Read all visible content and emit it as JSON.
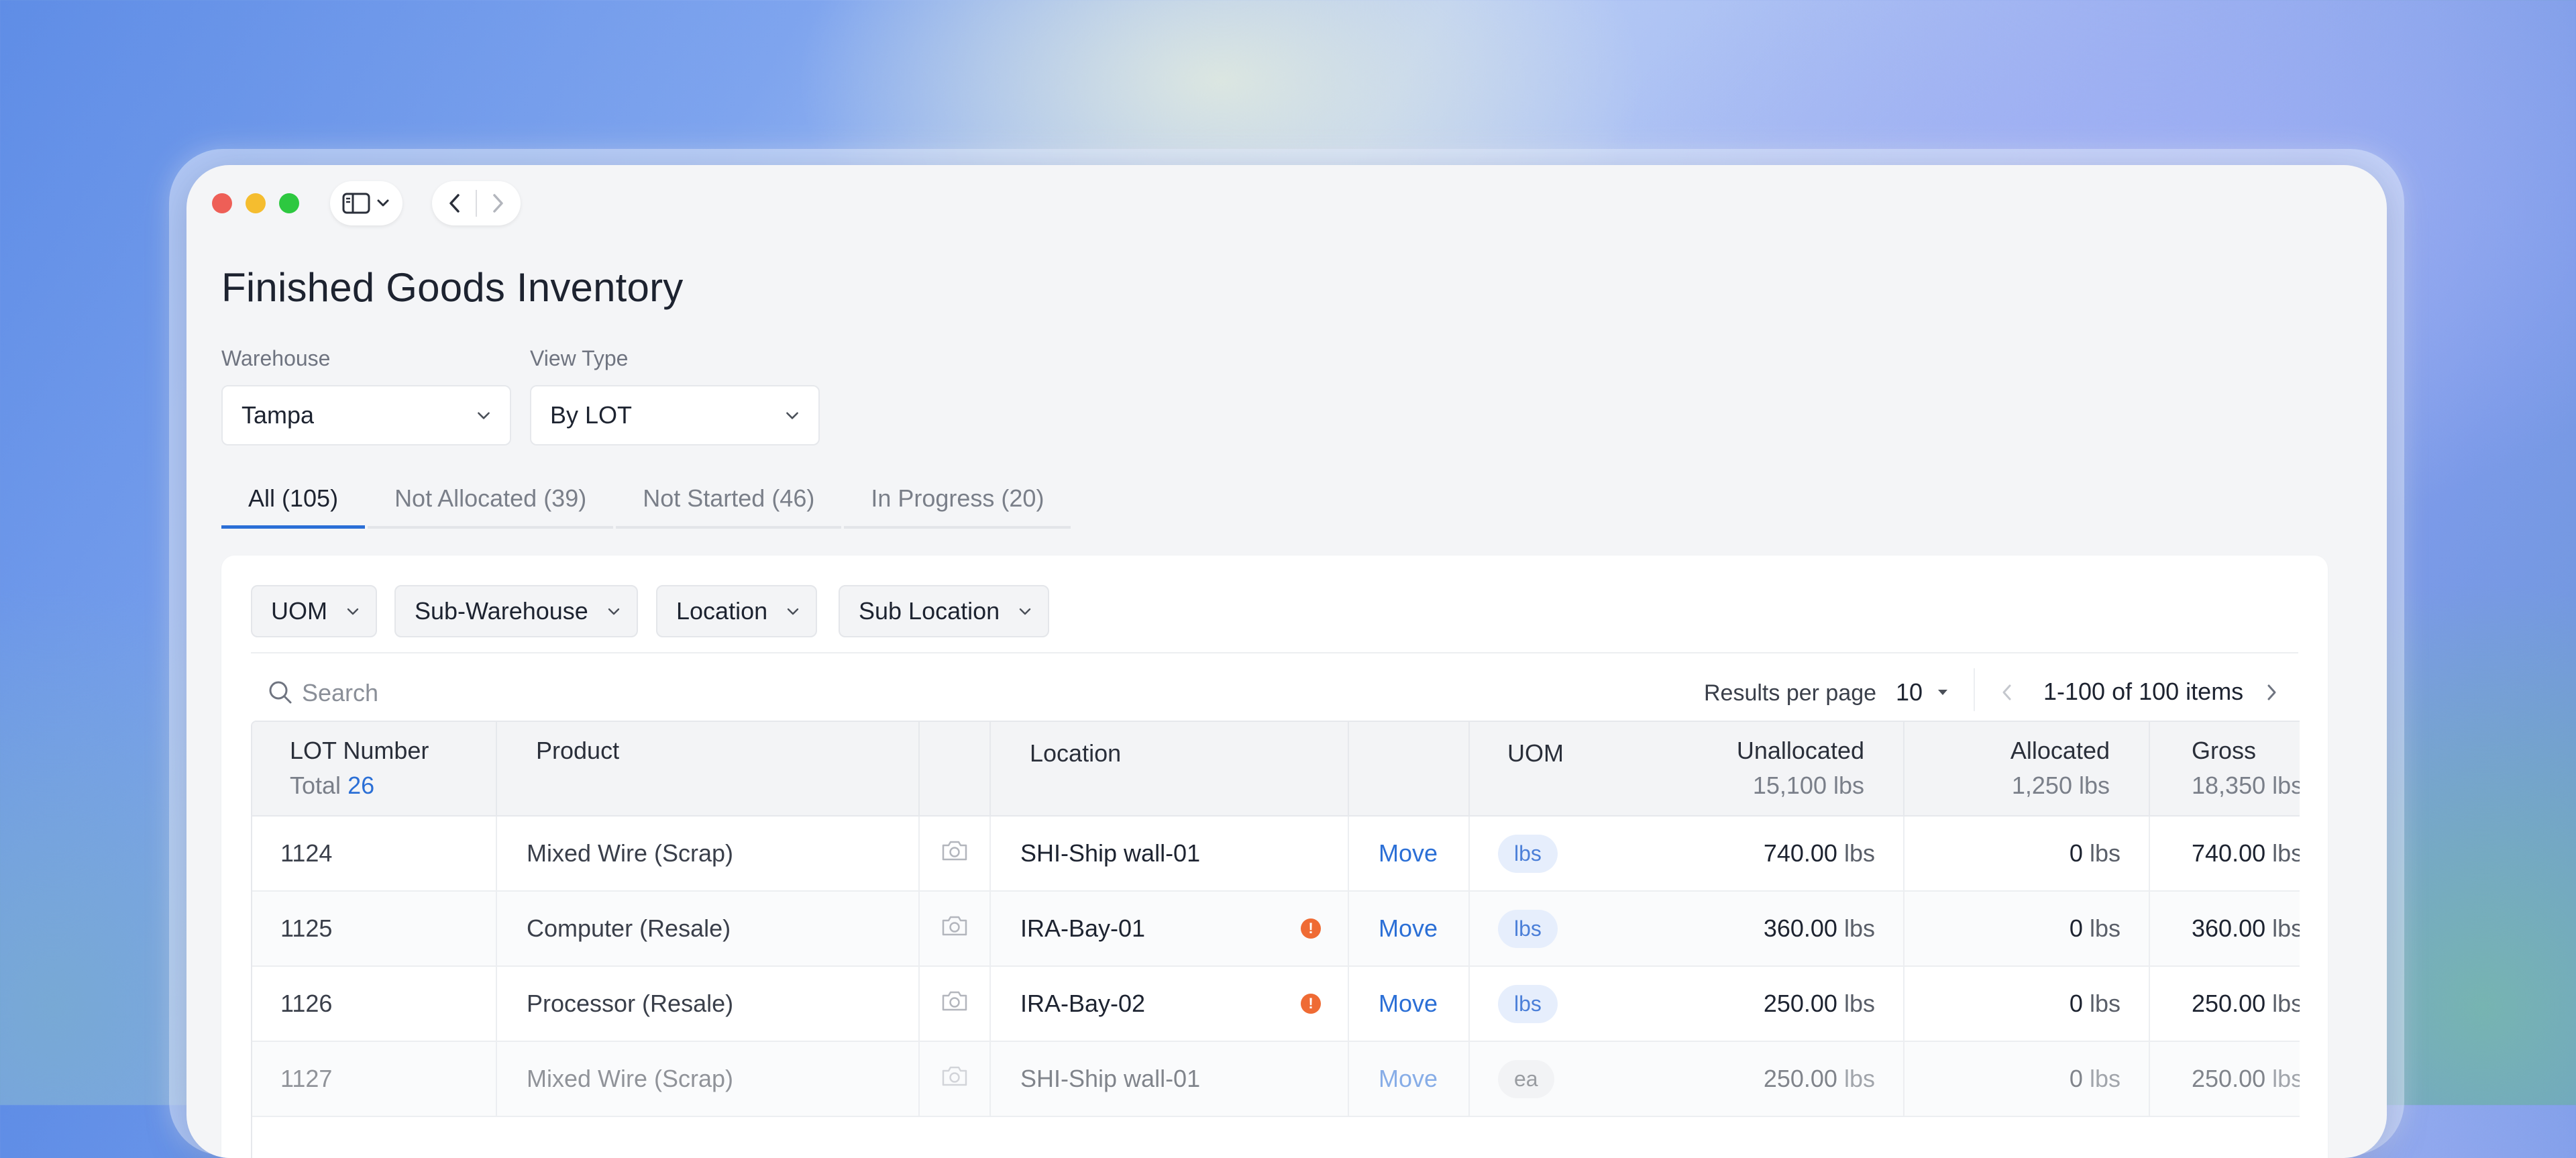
{
  "window": {
    "title": "Finished Goods Inventory"
  },
  "filters": {
    "warehouse": {
      "label": "Warehouse",
      "value": "Tampa"
    },
    "view_type": {
      "label": "View Type",
      "value": "By LOT"
    }
  },
  "tabs": [
    {
      "label": "All (105)",
      "active": true
    },
    {
      "label": "Not Allocated (39)",
      "active": false
    },
    {
      "label": "Not Started (46)",
      "active": false
    },
    {
      "label": "In Progress (20)",
      "active": false
    }
  ],
  "chips": [
    {
      "label": "UOM"
    },
    {
      "label": "Sub-Warehouse"
    },
    {
      "label": "Location"
    },
    {
      "label": "Sub Location"
    }
  ],
  "search": {
    "placeholder": "Search"
  },
  "pagination": {
    "results_label": "Results per page",
    "per_page": "10",
    "range": "1-100 of 100 items"
  },
  "table": {
    "headers": {
      "lot": "LOT Number",
      "lot_total_label": "Total",
      "lot_total_value": "26",
      "product": "Product",
      "location": "Location",
      "uom": "UOM",
      "unallocated": "Unallocated",
      "unallocated_total": "15,100 lbs",
      "allocated": "Allocated",
      "allocated_total": "1,250 lbs",
      "gross": "Gross",
      "gross_total": "18,350 lbs"
    },
    "rows": [
      {
        "lot": "1124",
        "product": "Mixed Wire (Scrap)",
        "location": "SHI-Ship wall-01",
        "warning": false,
        "action": "Move",
        "uom": "lbs",
        "unallocated": "740.00",
        "unallocated_unit": "lbs",
        "allocated": "0",
        "allocated_unit": "lbs",
        "gross": "740.00",
        "gross_unit": "lbs"
      },
      {
        "lot": "1125",
        "product": "Computer (Resale)",
        "location": "IRA-Bay-01",
        "warning": true,
        "action": "Move",
        "uom": "lbs",
        "unallocated": "360.00",
        "unallocated_unit": "lbs",
        "allocated": "0",
        "allocated_unit": "lbs",
        "gross": "360.00",
        "gross_unit": "lbs"
      },
      {
        "lot": "1126",
        "product": "Processor (Resale)",
        "location": "IRA-Bay-02",
        "warning": true,
        "action": "Move",
        "uom": "lbs",
        "unallocated": "250.00",
        "unallocated_unit": "lbs",
        "allocated": "0",
        "allocated_unit": "lbs",
        "gross": "250.00",
        "gross_unit": "lbs"
      },
      {
        "lot": "1127",
        "product": "Mixed Wire (Scrap)",
        "location": "SHI-Ship wall-01",
        "warning": false,
        "action": "Move",
        "uom": "ea",
        "unallocated": "250.00",
        "unallocated_unit": "lbs",
        "allocated": "0",
        "allocated_unit": "lbs",
        "gross": "250.00",
        "gross_unit": "lbs"
      }
    ]
  },
  "colors": {
    "accent": "#2b6fd6",
    "warning": "#ef6b34",
    "traffic_red": "#ee5f57",
    "traffic_yellow": "#f5bd2f",
    "traffic_green": "#2dc840"
  }
}
